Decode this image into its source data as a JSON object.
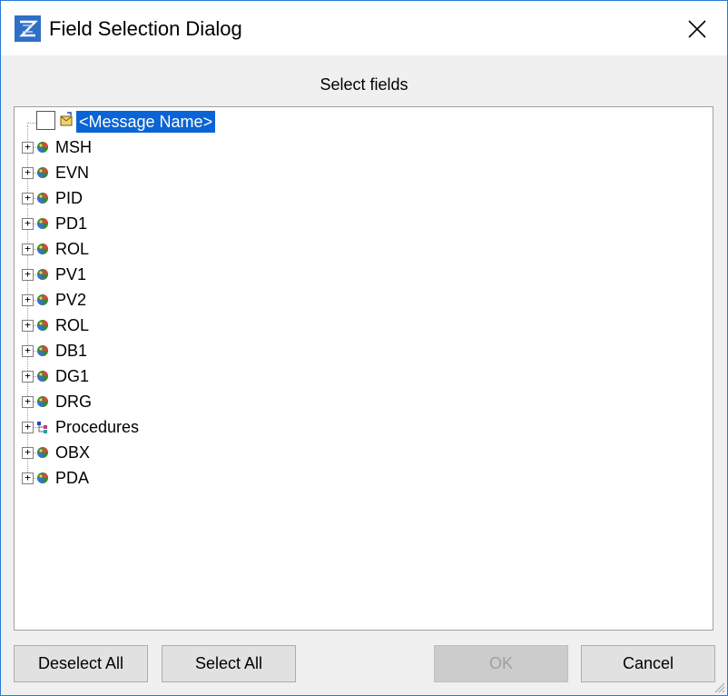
{
  "window": {
    "title": "Field Selection Dialog",
    "heading": "Select fields"
  },
  "tree": {
    "root": {
      "label": "<Message Name>",
      "checked": false,
      "selected": true,
      "icon": "message-icon"
    },
    "items": [
      {
        "label": "MSH",
        "icon": "segment-globe-icon"
      },
      {
        "label": "EVN",
        "icon": "segment-globe-icon"
      },
      {
        "label": "PID",
        "icon": "segment-globe-icon"
      },
      {
        "label": "PD1",
        "icon": "segment-globe-icon"
      },
      {
        "label": "ROL",
        "icon": "segment-globe-icon"
      },
      {
        "label": "PV1",
        "icon": "segment-globe-icon"
      },
      {
        "label": "PV2",
        "icon": "segment-globe-icon"
      },
      {
        "label": "ROL",
        "icon": "segment-globe-icon"
      },
      {
        "label": "DB1",
        "icon": "segment-globe-icon"
      },
      {
        "label": "DG1",
        "icon": "segment-globe-icon"
      },
      {
        "label": "DRG",
        "icon": "segment-globe-icon"
      },
      {
        "label": "Procedures",
        "icon": "group-icon"
      },
      {
        "label": "OBX",
        "icon": "segment-globe-icon"
      },
      {
        "label": "PDA",
        "icon": "segment-globe-icon"
      }
    ],
    "expander_glyph": "+"
  },
  "buttons": {
    "deselect_all": "Deselect All",
    "select_all": "Select All",
    "ok": "OK",
    "cancel": "Cancel"
  },
  "colors": {
    "selection": "#0a64d6",
    "accent_border": "#2b79d4",
    "disabled_text": "#a0a0a0"
  }
}
